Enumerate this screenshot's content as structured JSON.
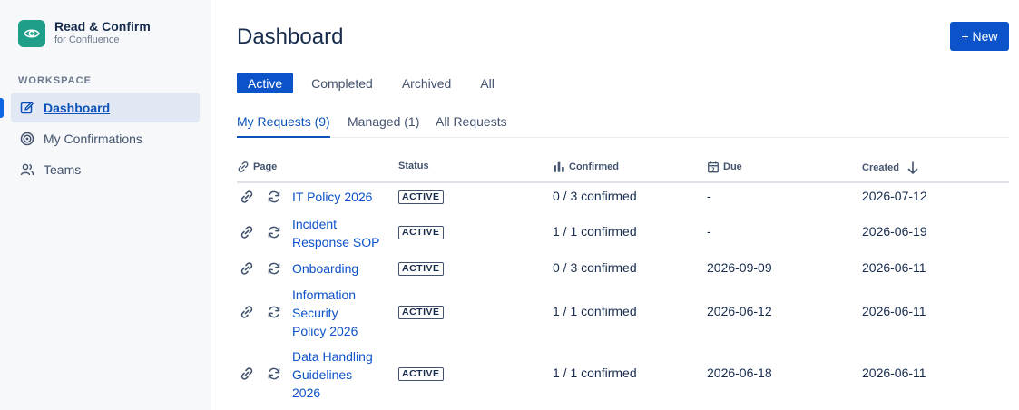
{
  "app": {
    "title": "Read & Confirm",
    "subtitle": "for Confluence"
  },
  "sidebar": {
    "section_label": "WORKSPACE",
    "items": [
      {
        "label": "Dashboard",
        "icon": "edit-icon",
        "active": true
      },
      {
        "label": "My Confirmations",
        "icon": "target-icon",
        "active": false
      },
      {
        "label": "Teams",
        "icon": "people-icon",
        "active": false
      }
    ]
  },
  "header": {
    "title": "Dashboard",
    "new_button": "+ New"
  },
  "status_tabs": [
    "Active",
    "Completed",
    "Archived",
    "All"
  ],
  "sub_tabs": [
    "My Requests (9)",
    "Managed (1)",
    "All Requests"
  ],
  "table": {
    "headers": {
      "page": "Page",
      "status": "Status",
      "confirmed": "Confirmed",
      "due": "Due",
      "created": "Created"
    },
    "rows": [
      {
        "page": "IT Policy 2026",
        "status": "ACTIVE",
        "confirmed": "0 / 3 confirmed",
        "due": "-",
        "created": "2026-07-12"
      },
      {
        "page": "Incident Response SOP",
        "status": "ACTIVE",
        "confirmed": "1 / 1 confirmed",
        "due": "-",
        "created": "2026-06-19"
      },
      {
        "page": "Onboarding",
        "status": "ACTIVE",
        "confirmed": "0 / 3 confirmed",
        "due": "2026-09-09",
        "created": "2026-06-11"
      },
      {
        "page": "Information Security Policy 2026",
        "status": "ACTIVE",
        "confirmed": "1 / 1 confirmed",
        "due": "2026-06-12",
        "created": "2026-06-11"
      },
      {
        "page": "Data Handling Guidelines 2026",
        "status": "ACTIVE",
        "confirmed": "1 / 1 confirmed",
        "due": "2026-06-18",
        "created": "2026-06-11"
      }
    ]
  },
  "colors": {
    "brand": "#1f9e8a",
    "primary": "#0c52c9",
    "link": "#0c52c9"
  }
}
